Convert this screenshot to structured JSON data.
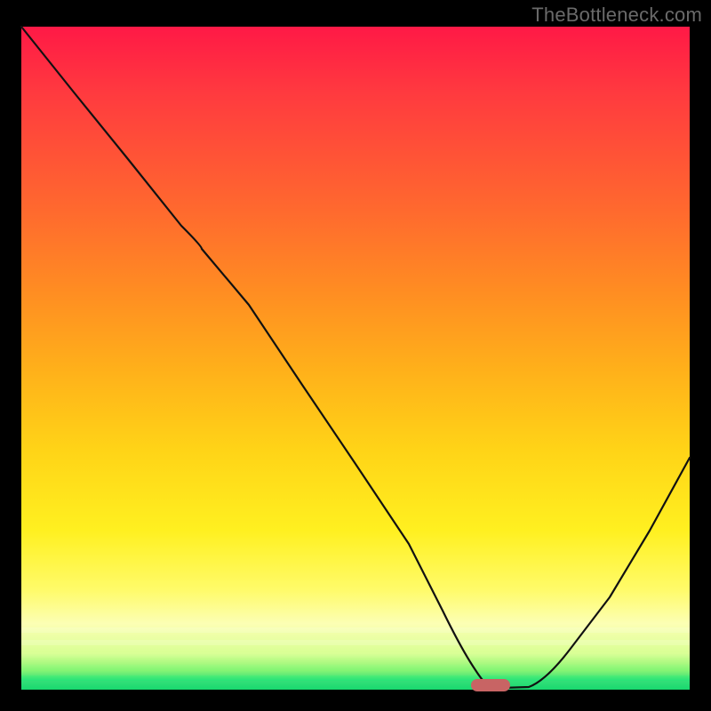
{
  "watermark": {
    "text": "TheBottleneck.com"
  },
  "chart_data": {
    "type": "line",
    "title": "",
    "xlabel": "",
    "ylabel": "",
    "xlim": [
      0,
      100
    ],
    "ylim": [
      0,
      100
    ],
    "x": [
      0,
      8,
      16,
      24,
      27,
      34,
      42,
      50,
      58,
      63,
      66,
      68,
      70,
      72,
      76,
      82,
      88,
      94,
      100
    ],
    "y": [
      100,
      90,
      80,
      70,
      67,
      58,
      46,
      34,
      22,
      12,
      6,
      3,
      1,
      0.5,
      0.7,
      6,
      14,
      24,
      35
    ],
    "marker": {
      "x": 70.5,
      "y": 0.5,
      "color": "#c86464"
    },
    "gradient_stops": [
      {
        "pos": 0.0,
        "color": "#ff1946"
      },
      {
        "pos": 0.28,
        "color": "#ff6a2e"
      },
      {
        "pos": 0.52,
        "color": "#ffb11a"
      },
      {
        "pos": 0.76,
        "color": "#fff020"
      },
      {
        "pos": 0.9,
        "color": "#fcffb4"
      },
      {
        "pos": 0.97,
        "color": "#8cf574"
      },
      {
        "pos": 1.0,
        "color": "#18d86f"
      }
    ]
  }
}
